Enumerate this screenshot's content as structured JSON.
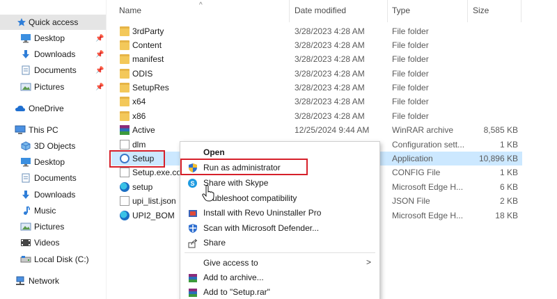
{
  "nav": {
    "items": [
      {
        "label": "Quick access",
        "icon": "star-icon",
        "pinned": false
      },
      {
        "label": "Desktop",
        "icon": "desktop-icon",
        "pinned": true
      },
      {
        "label": "Downloads",
        "icon": "download-icon",
        "pinned": true
      },
      {
        "label": "Documents",
        "icon": "documents-icon",
        "pinned": true
      },
      {
        "label": "Pictures",
        "icon": "pictures-icon",
        "pinned": true
      },
      {
        "label": "OneDrive",
        "icon": "cloud-icon",
        "pinned": false
      },
      {
        "label": "This PC",
        "icon": "pc-icon",
        "pinned": false
      },
      {
        "label": "3D Objects",
        "icon": "cube-icon",
        "pinned": false
      },
      {
        "label": "Desktop",
        "icon": "desktop-icon",
        "pinned": false
      },
      {
        "label": "Documents",
        "icon": "documents-icon",
        "pinned": false
      },
      {
        "label": "Downloads",
        "icon": "download-icon",
        "pinned": false
      },
      {
        "label": "Music",
        "icon": "music-icon",
        "pinned": false
      },
      {
        "label": "Pictures",
        "icon": "pictures-icon",
        "pinned": false
      },
      {
        "label": "Videos",
        "icon": "videos-icon",
        "pinned": false
      },
      {
        "label": "Local Disk (C:)",
        "icon": "disk-icon",
        "pinned": false
      },
      {
        "label": "Network",
        "icon": "network-icon",
        "pinned": false
      }
    ]
  },
  "columns": {
    "name": "Name",
    "date": "Date modified",
    "type": "Type",
    "size": "Size"
  },
  "files": [
    {
      "name": "3rdParty",
      "date": "3/28/2023 4:28 AM",
      "type": "File folder",
      "size": "",
      "icon": "folder-icon"
    },
    {
      "name": "Content",
      "date": "3/28/2023 4:28 AM",
      "type": "File folder",
      "size": "",
      "icon": "folder-icon"
    },
    {
      "name": "manifest",
      "date": "3/28/2023 4:28 AM",
      "type": "File folder",
      "size": "",
      "icon": "folder-icon"
    },
    {
      "name": "ODIS",
      "date": "3/28/2023 4:28 AM",
      "type": "File folder",
      "size": "",
      "icon": "folder-icon"
    },
    {
      "name": "SetupRes",
      "date": "3/28/2023 4:28 AM",
      "type": "File folder",
      "size": "",
      "icon": "folder-icon"
    },
    {
      "name": "x64",
      "date": "3/28/2023 4:28 AM",
      "type": "File folder",
      "size": "",
      "icon": "folder-icon"
    },
    {
      "name": "x86",
      "date": "3/28/2023 4:28 AM",
      "type": "File folder",
      "size": "",
      "icon": "folder-icon"
    },
    {
      "name": "Active",
      "date": "12/25/2024 9:44 AM",
      "type": "WinRAR archive",
      "size": "8,585 KB",
      "icon": "rar-icon"
    },
    {
      "name": "dlm",
      "date": "",
      "type": "Configuration sett...",
      "size": "1 KB",
      "icon": "doc-icon"
    },
    {
      "name": "Setup",
      "date": "",
      "type": "Application",
      "size": "10,896 KB",
      "icon": "app-icon"
    },
    {
      "name": "Setup.exe.co",
      "date": "",
      "type": "CONFIG File",
      "size": "1 KB",
      "icon": "doc-icon"
    },
    {
      "name": "setup",
      "date": "",
      "type": "Microsoft Edge H...",
      "size": "6 KB",
      "icon": "edge-icon"
    },
    {
      "name": "upi_list.json",
      "date": "",
      "type": "JSON File",
      "size": "2 KB",
      "icon": "doc-icon"
    },
    {
      "name": "UPI2_BOM",
      "date": "",
      "type": "Microsoft Edge H...",
      "size": "18 KB",
      "icon": "edge-icon"
    }
  ],
  "context_menu": {
    "items": [
      {
        "label": "Open",
        "icon": "",
        "bold": true
      },
      {
        "label": "Run as administrator",
        "icon": "shield-icon"
      },
      {
        "label": "Share with Skype",
        "icon": "skype-icon"
      },
      {
        "label": "Troubleshoot compatibility",
        "display": "ubleshoot compatibility",
        "icon": ""
      },
      {
        "label": "Install with Revo Uninstaller Pro",
        "icon": "revo-icon"
      },
      {
        "label": "Scan with Microsoft Defender...",
        "icon": "defender-icon"
      },
      {
        "label": "Share",
        "icon": "share-icon"
      },
      {
        "label": "Give access to",
        "icon": "",
        "submenu": true
      },
      {
        "label": "Add to archive...",
        "icon": "rar-icon"
      },
      {
        "label": "Add to \"Setup.rar\"",
        "icon": "rar-icon"
      }
    ]
  },
  "colors": {
    "selection": "#cce8ff",
    "nav_selected": "#e5e5e5",
    "highlight_box": "#d6202a",
    "folder": "#f3c85a"
  }
}
